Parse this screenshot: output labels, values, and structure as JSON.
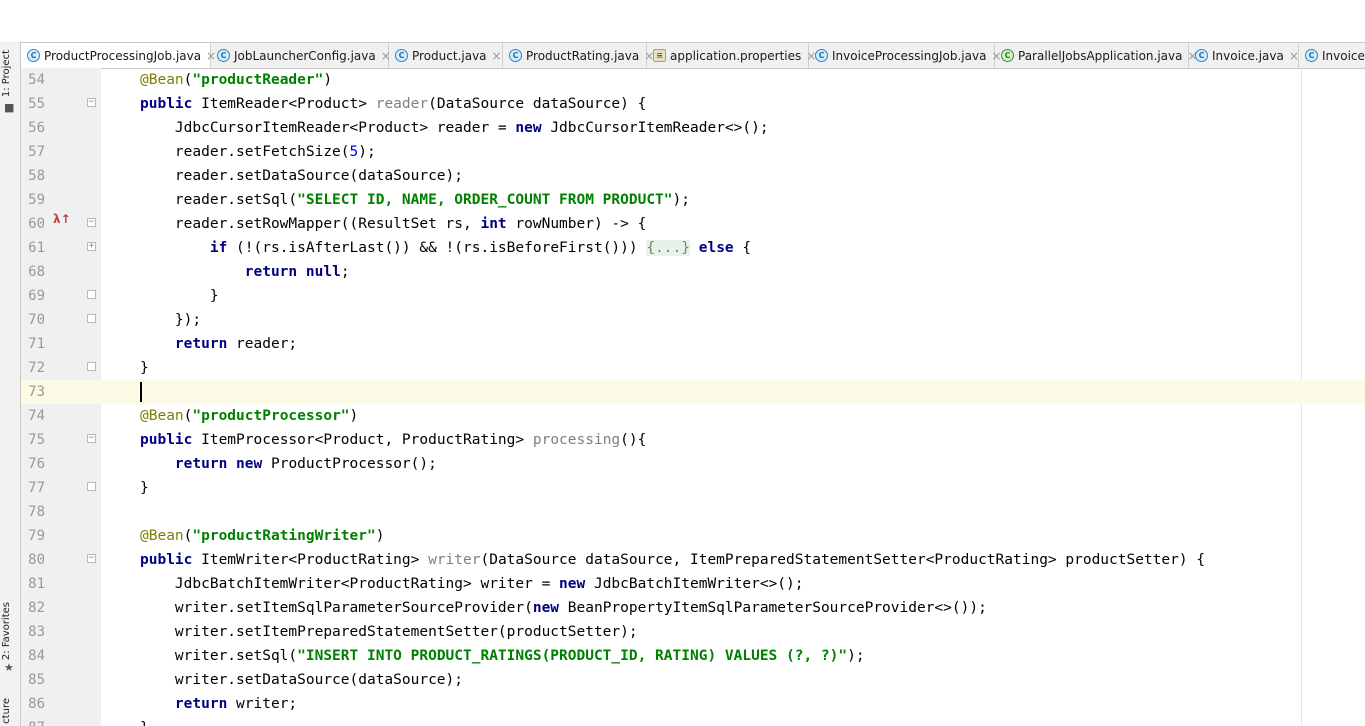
{
  "side_panel": {
    "project_label": "1: Project",
    "favorites_label": "2: Favorites",
    "structure_label": "cture"
  },
  "tabs": [
    {
      "label": "ProductProcessingJob.java",
      "icon": "class-icon",
      "active": true,
      "close": "×"
    },
    {
      "label": "JobLauncherConfig.java",
      "icon": "class-icon",
      "close": "×"
    },
    {
      "label": "Product.java",
      "icon": "class-icon",
      "close": "×"
    },
    {
      "label": "ProductRating.java",
      "icon": "class-icon",
      "close": "×"
    },
    {
      "label": "application.properties",
      "icon": "properties-file-icon",
      "close": "×"
    },
    {
      "label": "InvoiceProcessingJob.java",
      "icon": "class-icon",
      "close": "×"
    },
    {
      "label": "ParallelJobsApplication.java",
      "icon": "spring-boot-class-icon",
      "close": "×"
    },
    {
      "label": "Invoice.java",
      "icon": "class-icon",
      "close": "×"
    },
    {
      "label": "Invoicel",
      "icon": "class-icon",
      "close": ""
    }
  ],
  "editor": {
    "current_line": "73",
    "lines": [
      {
        "num": "54",
        "text": "@Bean(\"productReader\")"
      },
      {
        "num": "55",
        "text": "public ItemReader<Product> reader(DataSource dataSource) {"
      },
      {
        "num": "56",
        "text": "    JdbcCursorItemReader<Product> reader = new JdbcCursorItemReader<>();"
      },
      {
        "num": "57",
        "text": "    reader.setFetchSize(5);"
      },
      {
        "num": "58",
        "text": "    reader.setDataSource(dataSource);"
      },
      {
        "num": "59",
        "text": "    reader.setSql(\"SELECT ID, NAME, ORDER_COUNT FROM PRODUCT\");"
      },
      {
        "num": "60",
        "text": "    reader.setRowMapper((ResultSet rs, int rowNumber) -> {"
      },
      {
        "num": "61",
        "text": "        if (!(rs.isAfterLast()) && !(rs.isBeforeFirst())) {...} else {"
      },
      {
        "num": "68",
        "text": "            return null;"
      },
      {
        "num": "69",
        "text": "        }"
      },
      {
        "num": "70",
        "text": "    });"
      },
      {
        "num": "71",
        "text": "    return reader;"
      },
      {
        "num": "72",
        "text": "}"
      },
      {
        "num": "73",
        "text": ""
      },
      {
        "num": "74",
        "text": "@Bean(\"productProcessor\")"
      },
      {
        "num": "75",
        "text": "public ItemProcessor<Product, ProductRating> processing(){"
      },
      {
        "num": "76",
        "text": "    return new ProductProcessor();"
      },
      {
        "num": "77",
        "text": "}"
      },
      {
        "num": "78",
        "text": ""
      },
      {
        "num": "79",
        "text": "@Bean(\"productRatingWriter\")"
      },
      {
        "num": "80",
        "text": "public ItemWriter<ProductRating> writer(DataSource dataSource, ItemPreparedStatementSetter<ProductRating> productSetter) {"
      },
      {
        "num": "81",
        "text": "    JdbcBatchItemWriter<ProductRating> writer = new JdbcBatchItemWriter<>();"
      },
      {
        "num": "82",
        "text": "    writer.setItemSqlParameterSourceProvider(new BeanPropertyItemSqlParameterSourceProvider<>());"
      },
      {
        "num": "83",
        "text": "    writer.setItemPreparedStatementSetter(productSetter);"
      },
      {
        "num": "84",
        "text": "    writer.setSql(\"INSERT INTO PRODUCT_RATINGS(PRODUCT_ID, RATING) VALUES (?, ?)\");"
      },
      {
        "num": "85",
        "text": "    writer.setDataSource(dataSource);"
      },
      {
        "num": "86",
        "text": "    return writer;"
      },
      {
        "num": "87",
        "text": "}"
      }
    ]
  }
}
